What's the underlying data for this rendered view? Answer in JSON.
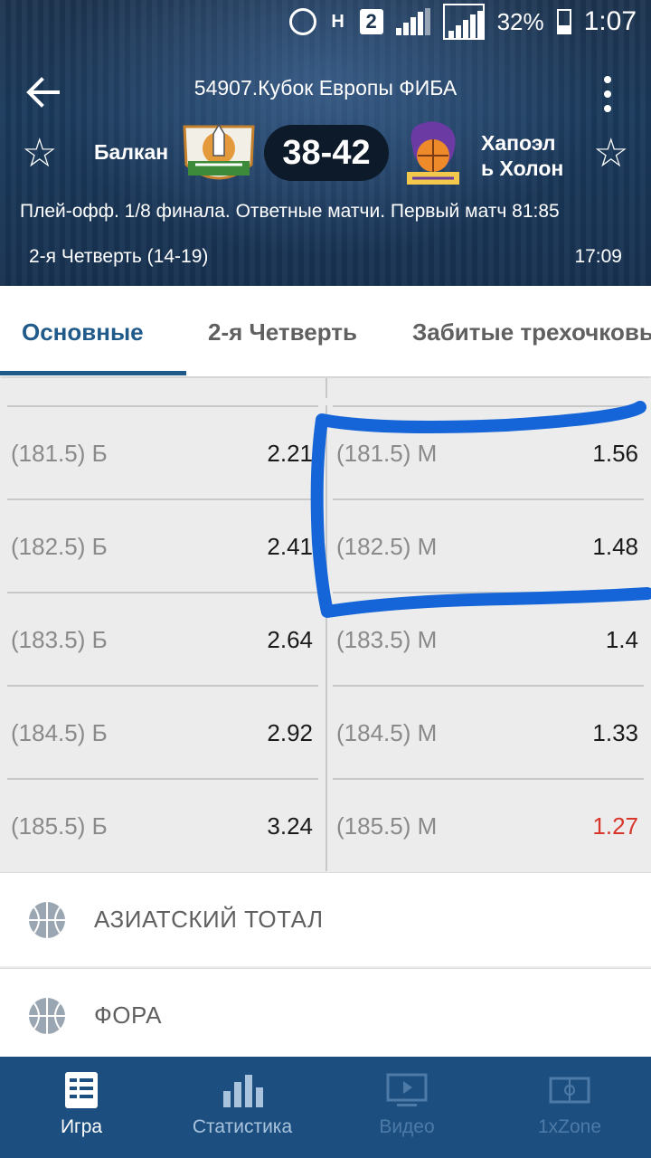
{
  "status_bar": {
    "battery": "32%",
    "time": "1:07",
    "sim_badge": "2",
    "network_letter": "H"
  },
  "header": {
    "title": "54907.Кубок Европы ФИБА",
    "team_home": "Балкан",
    "team_away_line1": "Хапоэл",
    "team_away_line2": "ь Холон",
    "score": "38-42",
    "subtitle": "Плей-офф. 1/8 финала. Ответные матчи. Первый матч 81:85",
    "period": "2-я  Четверть (14-19)",
    "clock": "17:09"
  },
  "tabs": [
    {
      "label": "Основные",
      "active": true
    },
    {
      "label": "2-я  Четверть",
      "active": false
    },
    {
      "label": "Забитые трехочковые",
      "active": false
    }
  ],
  "odds_rows": [
    {
      "over_label": "(181.5) Б",
      "over_value": "2.21",
      "under_label": "(181.5) М",
      "under_value": "1.56"
    },
    {
      "over_label": "(182.5) Б",
      "over_value": "2.41",
      "under_label": "(182.5) М",
      "under_value": "1.48"
    },
    {
      "over_label": "(183.5) Б",
      "over_value": "2.64",
      "under_label": "(183.5) М",
      "under_value": "1.4"
    },
    {
      "over_label": "(184.5) Б",
      "over_value": "2.92",
      "under_label": "(184.5) М",
      "under_value": "1.33"
    },
    {
      "over_label": "(185.5) Б",
      "over_value": "3.24",
      "under_label": "(185.5) М",
      "under_value": "1.27"
    }
  ],
  "colors": {
    "accent": "#1f5a8a",
    "odds_down": "#d9362b",
    "highlight_marker": "#1565d8",
    "bottom_nav": "#1c4f80"
  },
  "sections": [
    {
      "label": "АЗИАТСКИЙ ТОТАЛ",
      "icon": "basketball-icon"
    },
    {
      "label": "ФОРА",
      "icon": "basketball-icon"
    }
  ],
  "bottom_nav": [
    {
      "label": "Игра",
      "icon": "game-icon",
      "state": "active"
    },
    {
      "label": "Статистика",
      "icon": "bar-chart-icon",
      "state": "normal"
    },
    {
      "label": "Видео",
      "icon": "video-icon",
      "state": "disabled"
    },
    {
      "label": "1xZone",
      "icon": "field-icon",
      "state": "disabled"
    }
  ]
}
